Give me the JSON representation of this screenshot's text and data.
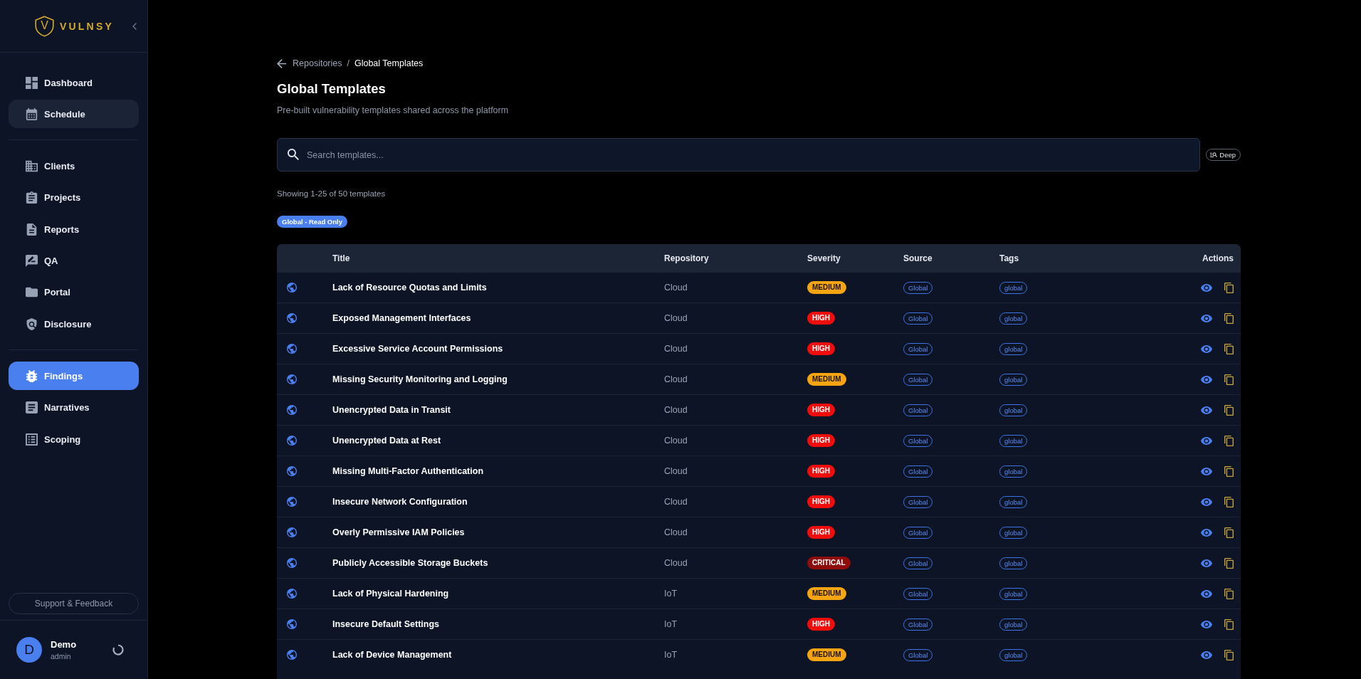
{
  "sidebar": {
    "logo": {
      "monogram": "V",
      "wordmark": "VULNSY"
    },
    "nav_groups": [
      {
        "items": [
          {
            "label": "Dashboard",
            "selected": false,
            "hovered": false
          },
          {
            "label": "Schedule",
            "selected": false,
            "hovered": true
          }
        ]
      },
      {
        "items": [
          {
            "label": "Clients",
            "selected": false,
            "hovered": false
          },
          {
            "label": "Projects",
            "selected": false,
            "hovered": false
          },
          {
            "label": "Reports",
            "selected": false,
            "hovered": false
          },
          {
            "label": "QA",
            "selected": false,
            "hovered": false
          },
          {
            "label": "Portal",
            "selected": false,
            "hovered": false
          },
          {
            "label": "Disclosure",
            "selected": false,
            "hovered": false
          }
        ]
      },
      {
        "items": [
          {
            "label": "Findings",
            "selected": true,
            "hovered": false
          },
          {
            "label": "Narratives",
            "selected": false,
            "hovered": false
          },
          {
            "label": "Scoping",
            "selected": false,
            "hovered": false
          }
        ]
      }
    ],
    "support_button": "Support & Feedback",
    "user": {
      "initial": "D",
      "name": "Demo",
      "role": "admin"
    }
  },
  "breadcrumb": {
    "parent": "Repositories",
    "separator": "/",
    "current": "Global Templates"
  },
  "header": {
    "title": "Global Templates",
    "subtitle": "Pre-built vulnerability templates shared across the platform"
  },
  "search": {
    "placeholder": "Search templates...",
    "deep_button": "Deep"
  },
  "result_count": "Showing 1-25 of 50 templates",
  "access_badge": "Global - Read Only",
  "table": {
    "columns": [
      "Title",
      "Repository",
      "Severity",
      "Source",
      "Tags",
      "Actions"
    ],
    "rows": [
      {
        "title": "Lack of Resource Quotas and Limits",
        "repository": "Cloud",
        "severity": {
          "label": "MEDIUM",
          "color": "#f5a511"
        },
        "source": "Global",
        "tags": [
          "global"
        ]
      },
      {
        "title": "Exposed Management Interfaces",
        "repository": "Cloud",
        "severity": {
          "label": "HIGH",
          "color": "#f20d0d"
        },
        "source": "Global",
        "tags": [
          "global"
        ]
      },
      {
        "title": "Excessive Service Account Permissions",
        "repository": "Cloud",
        "severity": {
          "label": "HIGH",
          "color": "#f20d0d"
        },
        "source": "Global",
        "tags": [
          "global"
        ]
      },
      {
        "title": "Missing Security Monitoring and Logging",
        "repository": "Cloud",
        "severity": {
          "label": "MEDIUM",
          "color": "#f5a511"
        },
        "source": "Global",
        "tags": [
          "global"
        ]
      },
      {
        "title": "Unencrypted Data in Transit",
        "repository": "Cloud",
        "severity": {
          "label": "HIGH",
          "color": "#f20d0d"
        },
        "source": "Global",
        "tags": [
          "global"
        ]
      },
      {
        "title": "Unencrypted Data at Rest",
        "repository": "Cloud",
        "severity": {
          "label": "HIGH",
          "color": "#f20d0d"
        },
        "source": "Global",
        "tags": [
          "global"
        ]
      },
      {
        "title": "Missing Multi-Factor Authentication",
        "repository": "Cloud",
        "severity": {
          "label": "HIGH",
          "color": "#f20d0d"
        },
        "source": "Global",
        "tags": [
          "global"
        ]
      },
      {
        "title": "Insecure Network Configuration",
        "repository": "Cloud",
        "severity": {
          "label": "HIGH",
          "color": "#f20d0d"
        },
        "source": "Global",
        "tags": [
          "global"
        ]
      },
      {
        "title": "Overly Permissive IAM Policies",
        "repository": "Cloud",
        "severity": {
          "label": "HIGH",
          "color": "#f20d0d"
        },
        "source": "Global",
        "tags": [
          "global"
        ]
      },
      {
        "title": "Publicly Accessible Storage Buckets",
        "repository": "Cloud",
        "severity": {
          "label": "CRITICAL",
          "color": "#8e0c0c"
        },
        "source": "Global",
        "tags": [
          "global"
        ]
      },
      {
        "title": "Lack of Physical Hardening",
        "repository": "IoT",
        "severity": {
          "label": "MEDIUM",
          "color": "#f5a511"
        },
        "source": "Global",
        "tags": [
          "global"
        ]
      },
      {
        "title": "Insecure Default Settings",
        "repository": "IoT",
        "severity": {
          "label": "HIGH",
          "color": "#f20d0d"
        },
        "source": "Global",
        "tags": [
          "global"
        ]
      },
      {
        "title": "Lack of Device Management",
        "repository": "IoT",
        "severity": {
          "label": "MEDIUM",
          "color": "#f5a511"
        },
        "source": "Global",
        "tags": [
          "global"
        ]
      }
    ]
  }
}
